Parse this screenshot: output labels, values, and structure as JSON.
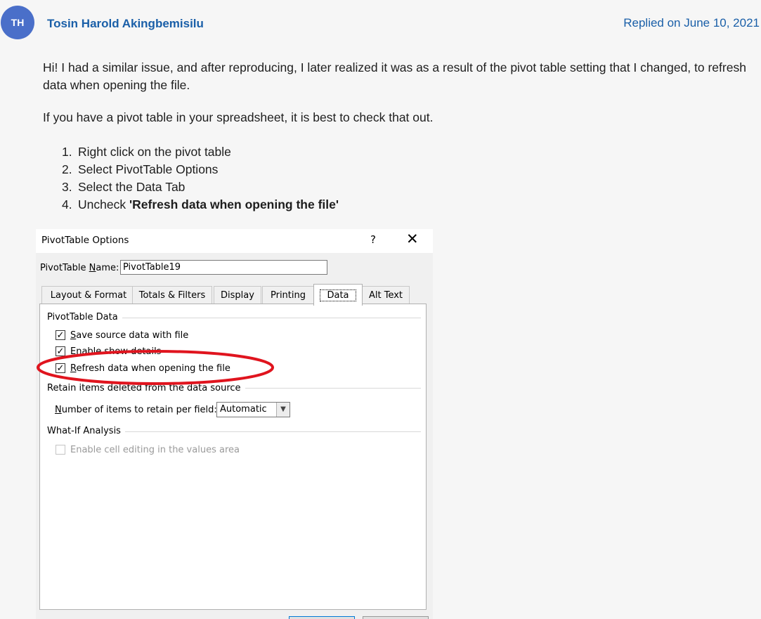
{
  "post": {
    "avatar_initials": "TH",
    "author": "Tosin Harold Akingbemisilu",
    "replied": "Replied on June 10, 2021",
    "paragraph1": "Hi! I had a similar issue, and after reproducing, I later realized it was as a result of the pivot table setting that I changed, to refresh data when opening the file.",
    "paragraph2": "If you have a pivot table in your spreadsheet, it is best to check that out.",
    "steps": [
      {
        "num": "1.",
        "text": "Right click on the pivot table"
      },
      {
        "num": "2.",
        "text": "Select PivotTable Options"
      },
      {
        "num": "3.",
        "text": "Select the Data Tab"
      },
      {
        "num": "4.",
        "prefix": "Uncheck ",
        "bold": "'Refresh data when opening the file'"
      }
    ]
  },
  "dialog": {
    "title": "PivotTable Options",
    "help_symbol": "?",
    "close_symbol": "✕",
    "name_label_pre": "PivotTable ",
    "name_label_key": "N",
    "name_label_post": "ame:",
    "name_value": "PivotTable19",
    "tabs": [
      "Layout & Format",
      "Totals & Filters",
      "Display",
      "Printing",
      "Data",
      "Alt Text"
    ],
    "active_tab": "Data",
    "group_pivot_data": "PivotTable Data",
    "checkboxes": [
      {
        "key": "S",
        "rest": "ave source data with file",
        "checked": true
      },
      {
        "key": "",
        "rest": "Enable show details",
        "checked": true
      },
      {
        "key": "R",
        "rest": "efresh data when opening the file",
        "checked": true
      }
    ],
    "group_retain": "Retain items deleted from the data source",
    "retain_label_key": "N",
    "retain_label_rest": "umber of items to retain per field:",
    "retain_value": "Automatic",
    "group_whatif": "What-If Analysis",
    "whatif_checkbox": "Enable cell editing in the values area",
    "annotation_color": "#e0141e"
  }
}
